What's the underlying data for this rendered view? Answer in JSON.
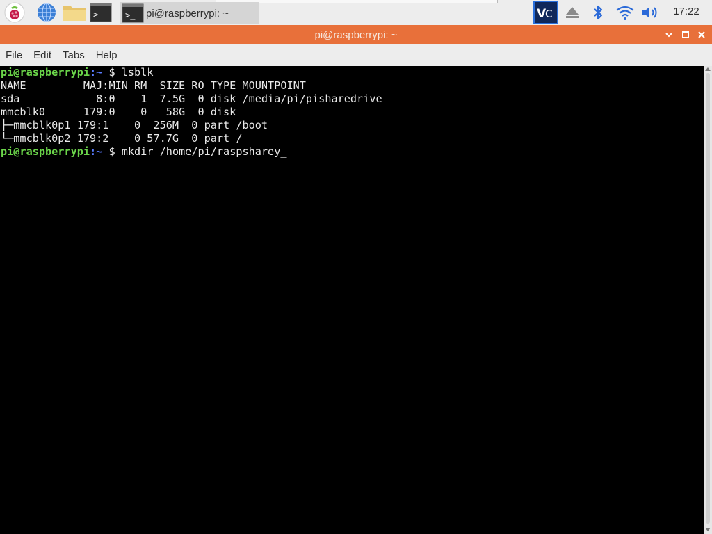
{
  "taskbar": {
    "window_button_label": "pi@raspberrypi: ~",
    "clock": "17:22"
  },
  "window": {
    "title": "pi@raspberrypi: ~",
    "title_color": "#e8703a"
  },
  "menubar": {
    "items": [
      "File",
      "Edit",
      "Tabs",
      "Help"
    ]
  },
  "terminal": {
    "lines": [
      {
        "user": "pi@raspberrypi",
        "path": ":~",
        "sym": " $ ",
        "cmd": "lsblk"
      },
      {
        "text": "NAME         MAJ:MIN RM  SIZE RO TYPE MOUNTPOINT"
      },
      {
        "text": "sda            8:0    1  7.5G  0 disk /media/pi/pisharedrive"
      },
      {
        "text": "mmcblk0      179:0    0   58G  0 disk "
      },
      {
        "text": "├─mmcblk0p1 179:1    0  256M  0 part /boot"
      },
      {
        "text": "└─mmcblk0p2 179:2    0 57.7G  0 part /"
      },
      {
        "user": "pi@raspberrypi",
        "path": ":~",
        "sym": " $ ",
        "cmd": "mkdir /home/pi/raspsharey_"
      }
    ]
  },
  "colors": {
    "prompt_user": "#6bd54a",
    "prompt_path": "#5a7cff",
    "terminal_bg": "#000000",
    "terminal_fg": "#e8e8e8"
  }
}
